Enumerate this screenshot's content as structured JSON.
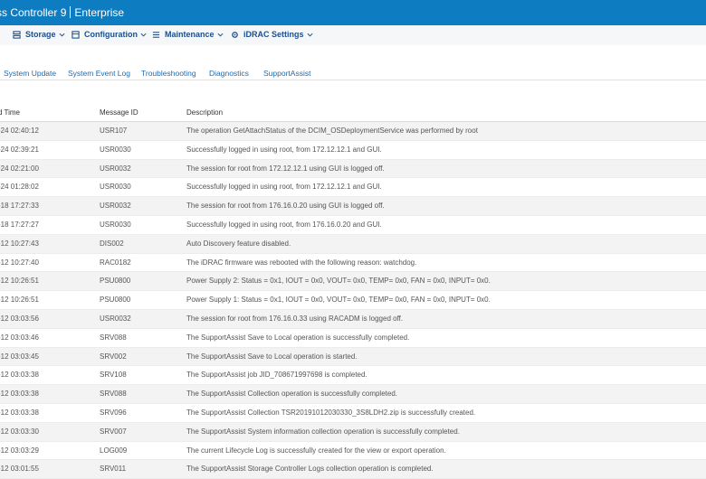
{
  "app": {
    "title_fragment": "ss Controller 9",
    "edition": "Enterprise"
  },
  "menu": [
    {
      "label": "Storage",
      "icon": "storage-icon"
    },
    {
      "label": "Configuration",
      "icon": "configuration-icon"
    },
    {
      "label": "Maintenance",
      "icon": "maintenance-icon"
    },
    {
      "label": "iDRAC Settings",
      "icon": "idrac-settings-icon"
    }
  ],
  "tabs": [
    "System Update",
    "System Event Log",
    "Troubleshooting",
    "Diagnostics",
    "SupportAssist"
  ],
  "table": {
    "headers": [
      "d Time",
      "Message ID",
      "Description"
    ],
    "rows": [
      {
        "time": "-24 02:40:12",
        "id": "USR107",
        "desc": "The operation GetAttachStatus of the DCIM_OSDeploymentService was performed by root"
      },
      {
        "time": "-24 02:39:21",
        "id": "USR0030",
        "desc": "Successfully logged in using root, from 172.12.12.1 and GUI."
      },
      {
        "time": "-24 02:21:00",
        "id": "USR0032",
        "desc": "The session for root from 172.12.12.1 using GUI is logged off."
      },
      {
        "time": "-24 01:28:02",
        "id": "USR0030",
        "desc": "Successfully logged in using root, from 172.12.12.1 and GUI."
      },
      {
        "time": "-18 17:27:33",
        "id": "USR0032",
        "desc": "The session for root from 176.16.0.20 using GUI is logged off."
      },
      {
        "time": "-18 17:27:27",
        "id": "USR0030",
        "desc": "Successfully logged in using root, from 176.16.0.20 and GUI."
      },
      {
        "time": "-12 10:27:43",
        "id": "DIS002",
        "desc": "Auto Discovery feature disabled."
      },
      {
        "time": "-12 10:27:40",
        "id": "RAC0182",
        "desc": "The iDRAC firmware was rebooted with the following reason: watchdog."
      },
      {
        "time": "-12 10:26:51",
        "id": "PSU0800",
        "desc": "Power Supply 2: Status = 0x1, IOUT = 0x0, VOUT= 0x0, TEMP= 0x0, FAN = 0x0, INPUT= 0x0."
      },
      {
        "time": "-12 10:26:51",
        "id": "PSU0800",
        "desc": "Power Supply 1: Status = 0x1, IOUT = 0x0, VOUT= 0x0, TEMP= 0x0, FAN = 0x0, INPUT= 0x0."
      },
      {
        "time": "-12 03:03:56",
        "id": "USR0032",
        "desc": "The session for root from 176.16.0.33 using RACADM is logged off."
      },
      {
        "time": "-12 03:03:46",
        "id": "SRV088",
        "desc": "The SupportAssist Save to Local operation is successfully completed."
      },
      {
        "time": "-12 03:03:45",
        "id": "SRV002",
        "desc": "The SupportAssist Save to Local operation is started."
      },
      {
        "time": "-12 03:03:38",
        "id": "SRV108",
        "desc": "The SupportAssist job JID_708671997698 is completed."
      },
      {
        "time": "-12 03:03:38",
        "id": "SRV088",
        "desc": "The SupportAssist Collection operation is successfully completed."
      },
      {
        "time": "-12 03:03:38",
        "id": "SRV096",
        "desc": "The SupportAssist Collection TSR20191012030330_3S8LDH2.zip is successfully created."
      },
      {
        "time": "-12 03:03:30",
        "id": "SRV007",
        "desc": "The SupportAssist System information collection operation is successfully completed."
      },
      {
        "time": "-12 03:03:29",
        "id": "LOG009",
        "desc": "The current Lifecycle Log is successfully created for the view or export operation."
      },
      {
        "time": "-12 03:01:55",
        "id": "SRV011",
        "desc": "The SupportAssist Storage Controller Logs collection operation is completed."
      }
    ]
  },
  "colors": {
    "header_bar": "#0e7cc1",
    "menu_text": "#1a4f8f",
    "tab_text": "#1e6bb0"
  }
}
